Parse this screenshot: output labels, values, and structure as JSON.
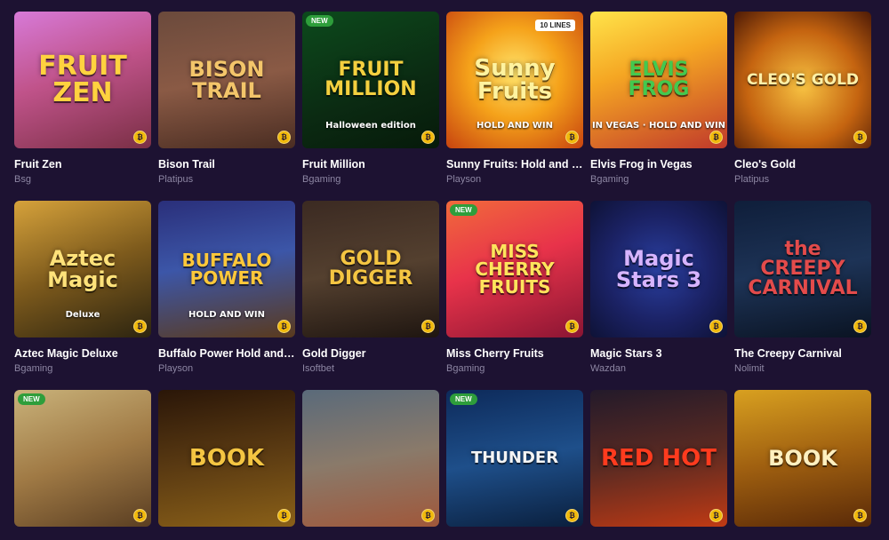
{
  "games": [
    {
      "title": "Fruit Zen",
      "provider": "Bsg",
      "art": "FRUIT ZEN",
      "bg": "linear-gradient(160deg,#d77ad8 0%,#c0538a 45%,#7a2f45 100%)",
      "artColor": "#ffd23f",
      "artSize": 30
    },
    {
      "title": "Bison Trail",
      "provider": "Platipus",
      "art": "BISON TRAIL",
      "bg": "linear-gradient(170deg,#6b4a3c 0%,#8a5a45 50%,#4a2d22 100%)",
      "artColor": "#f3c56a",
      "artSize": 24
    },
    {
      "title": "Fruit Million",
      "provider": "Bgaming",
      "art": "FRUIT MILLION",
      "sub": "Halloween edition",
      "new": "NEW",
      "bg": "linear-gradient(160deg,#0c4a1c 0%,#0b2a12 60%,#061a0a 100%)",
      "artColor": "#f4d03f",
      "artSize": 22
    },
    {
      "title": "Sunny Fruits: Hold and Win",
      "provider": "Playson",
      "art": "Sunny Fruits",
      "sub": "HOLD AND WIN",
      "lines": "10 LINES",
      "bg": "radial-gradient(circle at 50% 45%,#ffe36b 0%,#f5a21a 45%,#c7430f 100%)",
      "artColor": "#fff3a0",
      "artSize": 26
    },
    {
      "title": "Elvis Frog in Vegas",
      "provider": "Bgaming",
      "art": "ELVIS FROG",
      "sub": "IN VEGAS · HOLD AND WIN",
      "bg": "linear-gradient(160deg,#ffe44a 0%,#f5a623 40%,#c0392b 100%)",
      "artColor": "#43c94f",
      "artSize": 22
    },
    {
      "title": "Cleo's Gold",
      "provider": "Platipus",
      "art": "CLEO'S GOLD",
      "bg": "radial-gradient(circle at 50% 55%,#f7c242 0%,#c56410 55%,#4d1a06 100%)",
      "artColor": "#fff0a8",
      "artSize": 17
    },
    {
      "title": "Aztec Magic Deluxe",
      "provider": "Bgaming",
      "art": "Aztec Magic",
      "sub": "Deluxe",
      "bg": "linear-gradient(160deg,#d6a23b 0%,#7d5a1c 50%,#2c2410 100%)",
      "artColor": "#ffe27a",
      "artSize": 24
    },
    {
      "title": "Buffalo Power Hold and Win",
      "provider": "Playson",
      "art": "BUFFALO POWER",
      "sub": "HOLD AND WIN",
      "bg": "linear-gradient(170deg,#2a2f7a 0%,#3c56a8 45%,#5a3a1d 100%)",
      "artColor": "#ffc83a",
      "artSize": 20
    },
    {
      "title": "Gold Digger",
      "provider": "Isoftbet",
      "art": "GOLD DIGGER",
      "bg": "linear-gradient(170deg,#3b2a22 0%,#54402f 50%,#1e1510 100%)",
      "artColor": "#f4c542",
      "artSize": 22
    },
    {
      "title": "Miss Cherry Fruits",
      "provider": "Bgaming",
      "art": "MISS CHERRY FRUITS",
      "new": "NEW",
      "bg": "linear-gradient(160deg,#f16a3b 0%,#e8334a 45%,#8a1533 100%)",
      "artColor": "#ffe45c",
      "artSize": 20
    },
    {
      "title": "Magic Stars 3",
      "provider": "Wazdan",
      "art": "Magic Stars 3",
      "bg": "radial-gradient(circle at 50% 50%,#2a3fa0 0%,#1b2265 55%,#0e1236 100%)",
      "artColor": "#d7b4ff",
      "artSize": 24
    },
    {
      "title": "The Creepy Carnival",
      "provider": "Nolimit",
      "art": "the CREEPY CARNIVAL",
      "bg": "linear-gradient(170deg,#0f1e3a 0%,#1d3356 50%,#0a1322 100%)",
      "artColor": "#e34b4b",
      "artSize": 22
    },
    {
      "title": "",
      "provider": "",
      "art": "",
      "new": "NEW",
      "bg": "linear-gradient(160deg,#c9b27a 0%,#a07a45 50%,#5a3e22 100%)",
      "artColor": "#ffffff",
      "artSize": 18
    },
    {
      "title": "",
      "provider": "",
      "art": "BOOK",
      "bg": "linear-gradient(170deg,#2a1608 0%,#5a3a12 50%,#8a6018 100%)",
      "artColor": "#f4c542",
      "artSize": 26
    },
    {
      "title": "",
      "provider": "",
      "art": "",
      "bg": "linear-gradient(170deg,#5a6a7a 0%,#8a7a6a 50%,#a0573a 100%)",
      "artColor": "#ffffff",
      "artSize": 18
    },
    {
      "title": "",
      "provider": "",
      "art": "THUNDER",
      "new": "NEW",
      "bg": "linear-gradient(170deg,#0d2a5a 0%,#1e4f8a 50%,#0a1f3d 100%)",
      "artColor": "#f4f4f4",
      "artSize": 18
    },
    {
      "title": "",
      "provider": "",
      "art": "RED HOT",
      "bg": "linear-gradient(170deg,#231a2a 0%,#5a2a22 50%,#c03a14 100%)",
      "artColor": "#ff3b1e",
      "artSize": 26
    },
    {
      "title": "",
      "provider": "",
      "art": "BOOK",
      "bg": "linear-gradient(170deg,#d8a020 0%,#a06010 50%,#5a2a08 100%)",
      "artColor": "#fff0c0",
      "artSize": 24
    }
  ]
}
